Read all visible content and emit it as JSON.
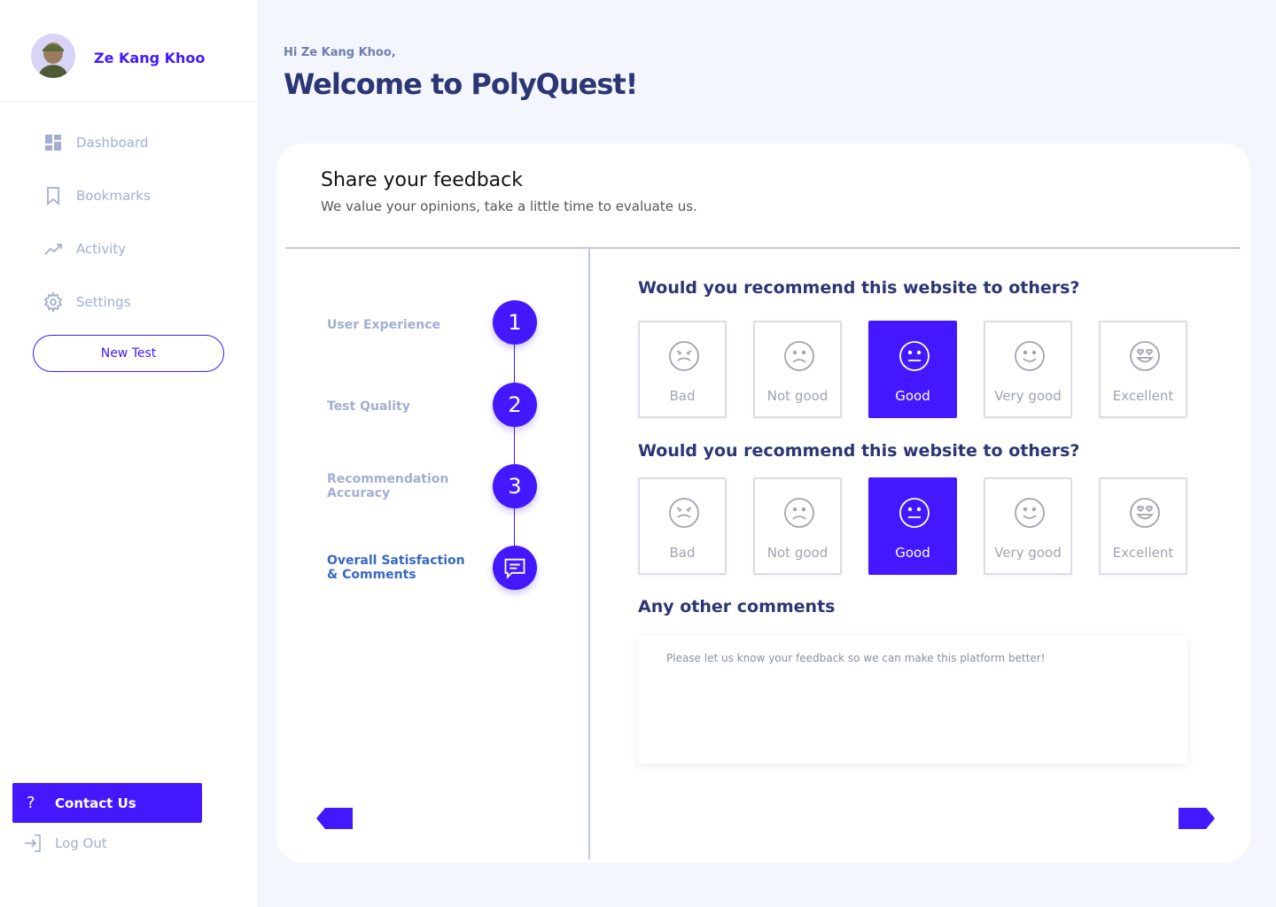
{
  "sidebar": {
    "profile_name": "Ze Kang Khoo",
    "nav": [
      {
        "label": "Dashboard",
        "icon": "dashboard-icon"
      },
      {
        "label": "Bookmarks",
        "icon": "bookmark-icon"
      },
      {
        "label": "Activity",
        "icon": "activity-icon"
      },
      {
        "label": "Settings",
        "icon": "gear-icon"
      }
    ],
    "new_test_label": "New Test",
    "contact_label": "Contact Us",
    "logout_label": "Log Out"
  },
  "header": {
    "greeting": "Hi Ze Kang Khoo,",
    "title": "Welcome to PolyQuest!"
  },
  "feedback": {
    "title": "Share your feedback",
    "subtitle": "We value your opinions, take a little time to evaluate us.",
    "steps": [
      {
        "label": "User Experience",
        "marker": "1",
        "active": false
      },
      {
        "label": "Test Quality",
        "marker": "2",
        "active": false
      },
      {
        "label": "Recommendation Accuracy",
        "marker": "3",
        "active": false
      },
      {
        "label": "Overall Satisfaction & Comments",
        "marker": "chat-icon",
        "active": true
      }
    ],
    "questions": [
      {
        "title": "Would you recommend this website to others?",
        "options": [
          "Bad",
          "Not good",
          "Good",
          "Very good",
          "Excellent"
        ],
        "selected": "Good"
      },
      {
        "title": "Would you recommend this website to others?",
        "options": [
          "Bad",
          "Not good",
          "Good",
          "Very good",
          "Excellent"
        ],
        "selected": "Good"
      }
    ],
    "comments_title": "Any other comments",
    "comments_placeholder": "Please let us know your feedback so we can make this platform better!"
  },
  "colors": {
    "accent": "#4318ff",
    "text_dark": "#2b3674",
    "text_muted": "#a3aed0",
    "background": "#f4f6fe"
  }
}
